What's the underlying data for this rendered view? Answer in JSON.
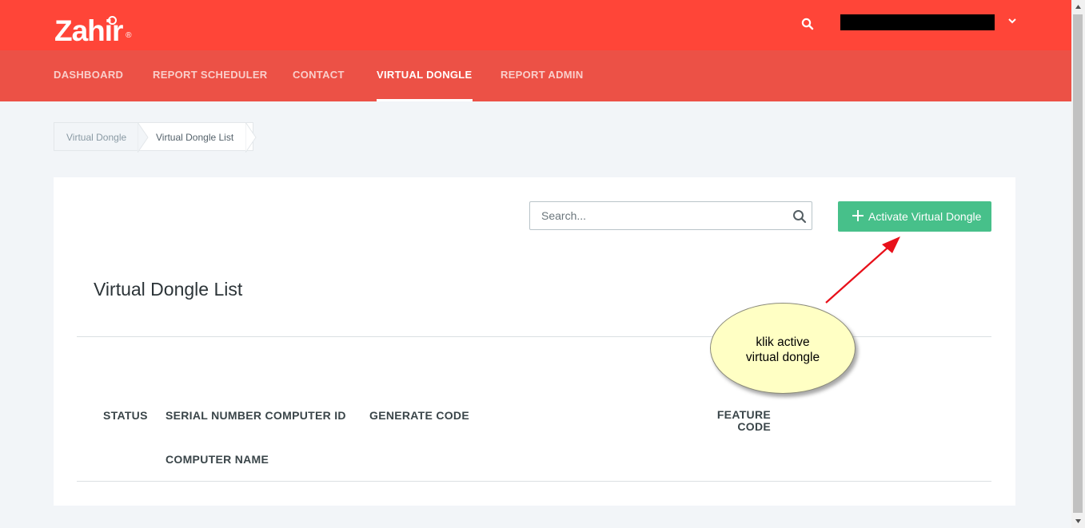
{
  "header": {
    "logo_text": "Zahir",
    "logo_reg": "®"
  },
  "nav": {
    "items": [
      {
        "label": "DASHBOARD"
      },
      {
        "label": "REPORT SCHEDULER"
      },
      {
        "label": "CONTACT"
      },
      {
        "label": "VIRTUAL DONGLE",
        "active": true
      },
      {
        "label": "REPORT ADMIN"
      }
    ]
  },
  "breadcrumb": {
    "items": [
      "Virtual Dongle",
      "Virtual Dongle List"
    ]
  },
  "toolbar": {
    "search_placeholder": "Search...",
    "activate_label": "Activate Virtual Dongle"
  },
  "list": {
    "title": "Virtual Dongle List",
    "columns": {
      "status": "STATUS",
      "serial": "SERIAL NUMBER COMPUTER ID",
      "generate": "GENERATE CODE",
      "feature_line1": "FEATURE",
      "feature_line2": "CODE",
      "computer_name": "COMPUTER NAME"
    }
  },
  "annotation": {
    "line1": "klik active",
    "line2": "virtual dongle"
  },
  "colors": {
    "brand": "#ff4538",
    "nav": "#ec5146",
    "accent_green": "#47c08a",
    "annotation_fill": "#ffffc4",
    "annotation_arrow": "#e8101a"
  }
}
